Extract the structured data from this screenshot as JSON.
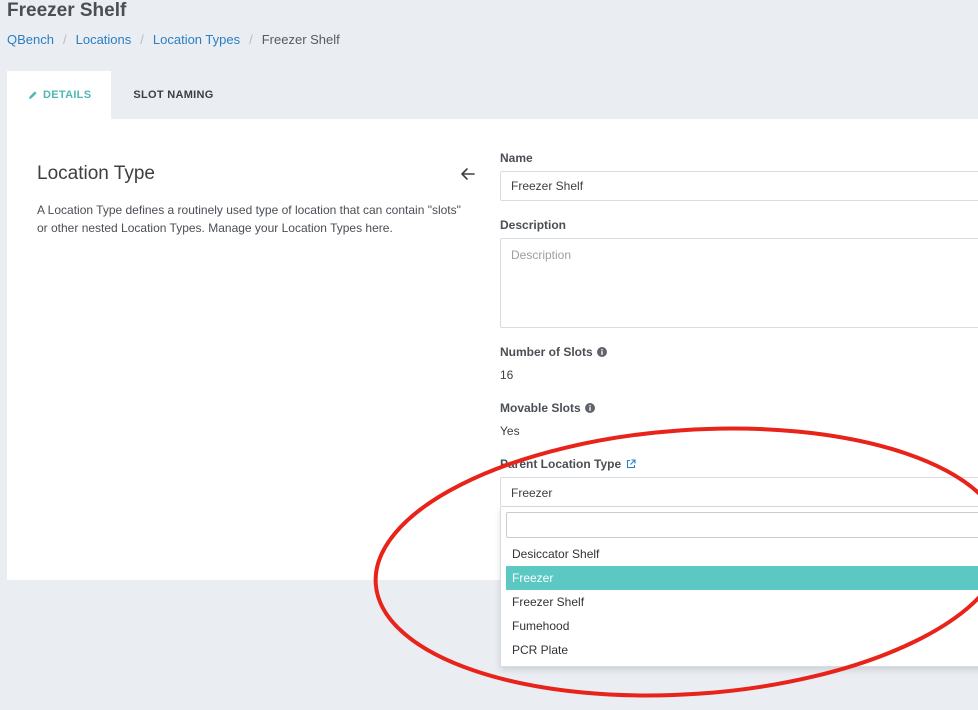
{
  "page": {
    "title": "Freezer Shelf"
  },
  "breadcrumb": [
    "QBench",
    "Locations",
    "Location Types",
    "Freezer Shelf"
  ],
  "tabs": {
    "details": "DETAILS",
    "slot_naming": "SLOT NAMING"
  },
  "section": {
    "title": "Location Type",
    "description": "A Location Type defines a routinely used type of location that can contain \"slots\" or other nested Location Types. Manage your Location Types here."
  },
  "form": {
    "name_label": "Name",
    "name_value": "Freezer Shelf",
    "description_label": "Description",
    "description_placeholder": "Description",
    "slots_label": "Number of Slots",
    "slots_value": "16",
    "movable_label": "Movable Slots",
    "movable_value": "Yes",
    "parent_label": "Parent Location Type",
    "parent_value": "Freezer"
  },
  "dropdown": {
    "options": [
      "Desiccator Shelf",
      "Freezer",
      "Freezer Shelf",
      "Fumehood",
      "PCR Plate"
    ],
    "selected": "Freezer"
  },
  "colors": {
    "accent": "#5bc8c4",
    "link": "#2a7fc4",
    "annotation": "#e8231a"
  },
  "icons": [
    "pencil-icon",
    "back-arrow-icon",
    "info-icon",
    "external-link-icon"
  ]
}
